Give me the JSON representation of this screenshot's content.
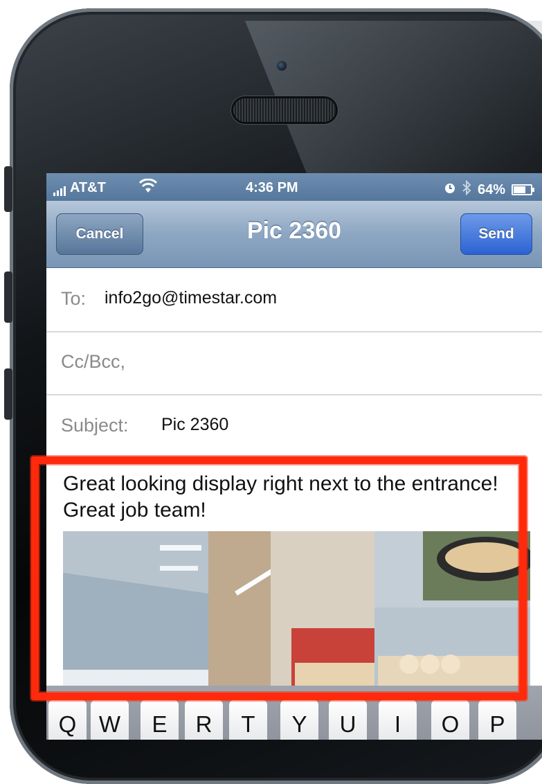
{
  "status_bar": {
    "carrier": "AT&T",
    "time": "4:36 PM",
    "battery_percent": "64%",
    "battery_level": 0.64,
    "icons": [
      "signal-bars-icon",
      "wifi-icon",
      "alarm-clock-icon",
      "bluetooth-icon",
      "battery-icon"
    ]
  },
  "nav": {
    "cancel_label": "Cancel",
    "title": "Pic 2360",
    "send_label": "Send"
  },
  "fields": {
    "to_label": "To:",
    "to_value": "info2go@timestar.com",
    "cc_label": "Cc/Bcc,",
    "subject_label": "Subject:",
    "subject_value": "Pic 2360"
  },
  "message": {
    "body": "Great looking display right next to the entrance!  Great job team!"
  },
  "keyboard": {
    "keys": [
      "Q",
      "W",
      "E",
      "R",
      "T",
      "Y",
      "U",
      "I",
      "O",
      "P"
    ]
  },
  "colors": {
    "annotation": "#ff2a0c",
    "send_button": "#2d62d3",
    "nav_bar": "#8da6c2"
  }
}
